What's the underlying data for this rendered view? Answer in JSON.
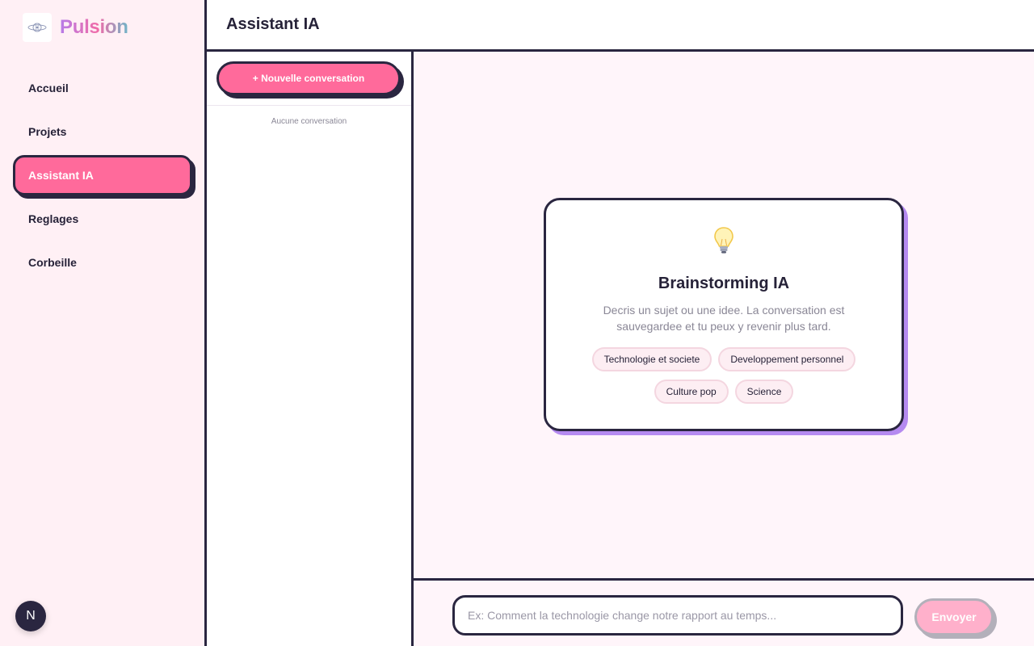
{
  "sidebar": {
    "brand": "Pulsion",
    "items": [
      {
        "label": "Accueil",
        "active": false
      },
      {
        "label": "Projets",
        "active": false
      },
      {
        "label": "Assistant IA",
        "active": true
      },
      {
        "label": "Reglages",
        "active": false
      },
      {
        "label": "Corbeille",
        "active": false
      }
    ],
    "avatar_letter": "N"
  },
  "header": {
    "title": "Assistant IA"
  },
  "conversations": {
    "new_label": "+ Nouvelle conversation",
    "empty_text": "Aucune conversation"
  },
  "welcome": {
    "icon": "lightbulb-icon",
    "title": "Brainstorming IA",
    "description": "Decris un sujet ou une idee. La conversation est sauvegardee et tu peux y revenir plus tard.",
    "suggestions": [
      "Technologie et societe",
      "Developpement personnel",
      "Culture pop",
      "Science"
    ]
  },
  "composer": {
    "placeholder": "Ex: Comment la technologie change notre rapport au temps...",
    "value": "",
    "send_label": "Envoyer"
  },
  "colors": {
    "accent": "#ff6a9b",
    "ink": "#2a2640",
    "card_shadow": "#b58af0",
    "sidebar_bg": "#fff0f5",
    "chat_bg": "#fff5fa"
  }
}
